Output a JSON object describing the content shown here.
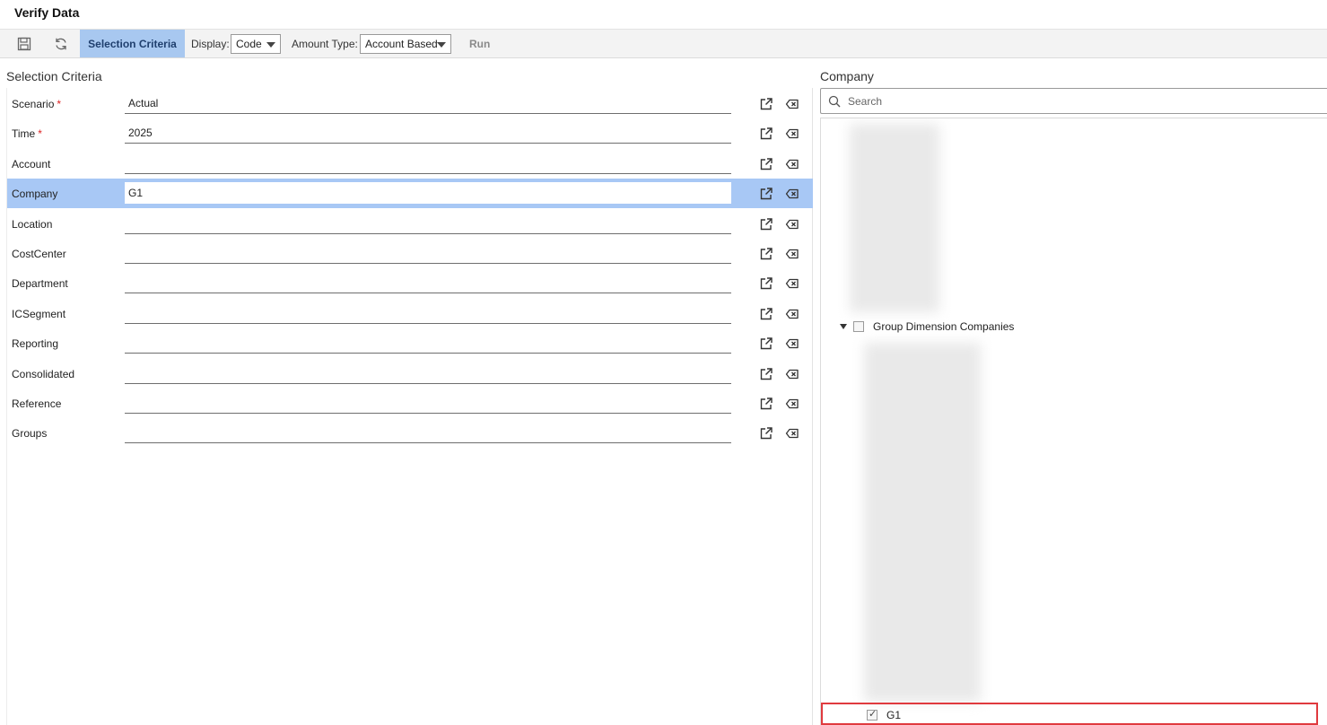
{
  "window": {
    "title": "Verify Data"
  },
  "toolbar": {
    "save_icon": "save-icon",
    "refresh_icon": "refresh-icon",
    "selection_criteria_label": "Selection Criteria",
    "display_label": "Display:",
    "display_value": "Code",
    "amount_type_label": "Amount Type:",
    "amount_type_value": "Account Based",
    "run_label": "Run"
  },
  "selection": {
    "title": "Selection Criteria",
    "rows": [
      {
        "label": "Scenario",
        "required": "*",
        "value": "Actual"
      },
      {
        "label": "Time",
        "required": "*",
        "value": "2025"
      },
      {
        "label": "Account",
        "required": "",
        "value": ""
      },
      {
        "label": "Company",
        "required": "",
        "value": "G1"
      },
      {
        "label": "Location",
        "required": "",
        "value": ""
      },
      {
        "label": "CostCenter",
        "required": "",
        "value": ""
      },
      {
        "label": "Department",
        "required": "",
        "value": ""
      },
      {
        "label": "ICSegment",
        "required": "",
        "value": ""
      },
      {
        "label": "Reporting",
        "required": "",
        "value": ""
      },
      {
        "label": "Consolidated",
        "required": "",
        "value": ""
      },
      {
        "label": "Reference",
        "required": "",
        "value": ""
      },
      {
        "label": "Groups",
        "required": "",
        "value": ""
      }
    ],
    "selected_row": "Company"
  },
  "company_panel": {
    "title": "Company",
    "search_placeholder": "Search",
    "group_node_label": "Group Dimension Companies",
    "selected_item_label": "G1"
  },
  "colors": {
    "selected_row": "#a8c8f5",
    "toolbar_tab": "#a8c8f0",
    "highlight": "#e03a3e",
    "required": "#dd2222"
  }
}
